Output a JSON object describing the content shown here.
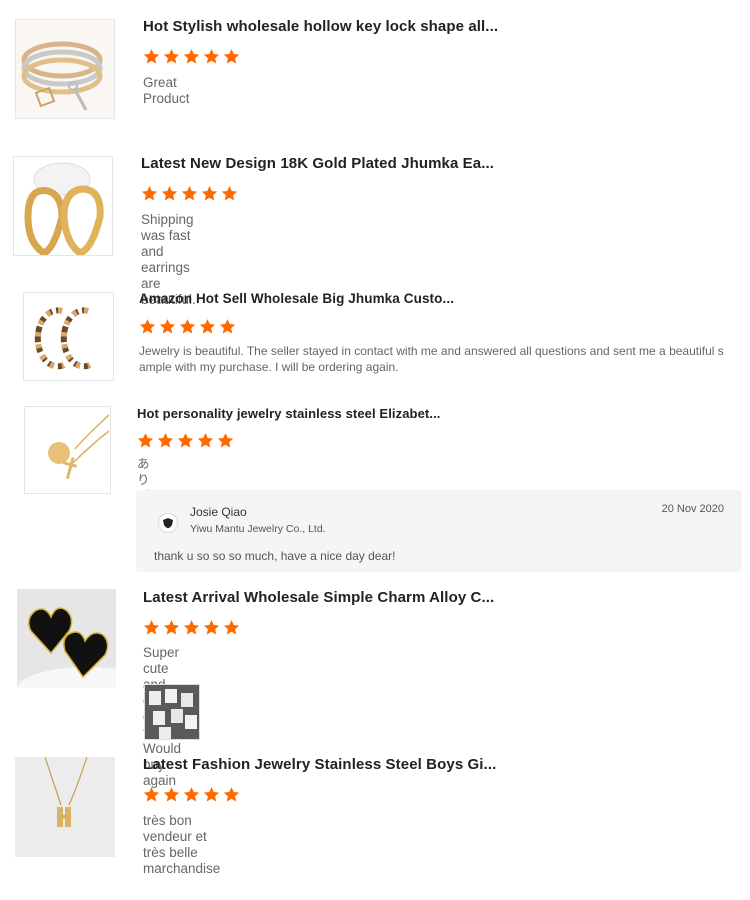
{
  "colors": {
    "star": "#ff6a00",
    "reply_bg": "#f4f5f7"
  },
  "reviews": [
    {
      "title": "Hot Stylish wholesale hollow key lock shape all...",
      "rating": 5,
      "text": "Great Product",
      "image_icon": "bracelet-image"
    },
    {
      "title": "Latest New Design 18K Gold Plated Jhumka Ea...",
      "rating": 5,
      "text": "Shipping was fast and earrings are beautiful.",
      "image_icon": "hoop-earrings-image"
    },
    {
      "title": "Amazon Hot Sell Wholesale Big Jhumka Custo...",
      "rating": 5,
      "text": "Jewelry is beautiful. The seller stayed in contact with me and answered all questions and sent me a beautiful sample with my purchase. I will be ordering again.",
      "image_icon": "c-hoop-earrings-image"
    },
    {
      "title": "Hot personality jewelry stainless steel Elizabet...",
      "rating": 5,
      "text": "ありがと",
      "image_icon": "necklace-image"
    },
    {
      "title": "Latest Arrival Wholesale Simple Charm Alloy C...",
      "rating": 5,
      "text": "Super cute and came on time! Would buy again",
      "image_icon": "heart-earrings-image"
    },
    {
      "title": "Latest Fashion Jewelry Stainless Steel Boys Gi...",
      "rating": 5,
      "text": "très bon vendeur et très belle marchandise",
      "image_icon": "letter-necklace-image"
    }
  ],
  "reply": {
    "name": "Josie Qiao",
    "company": "Yiwu Mantu Jewelry Co., Ltd.",
    "date": "20 Nov 2020",
    "text": "thank u so so so much, have a nice day dear!"
  }
}
